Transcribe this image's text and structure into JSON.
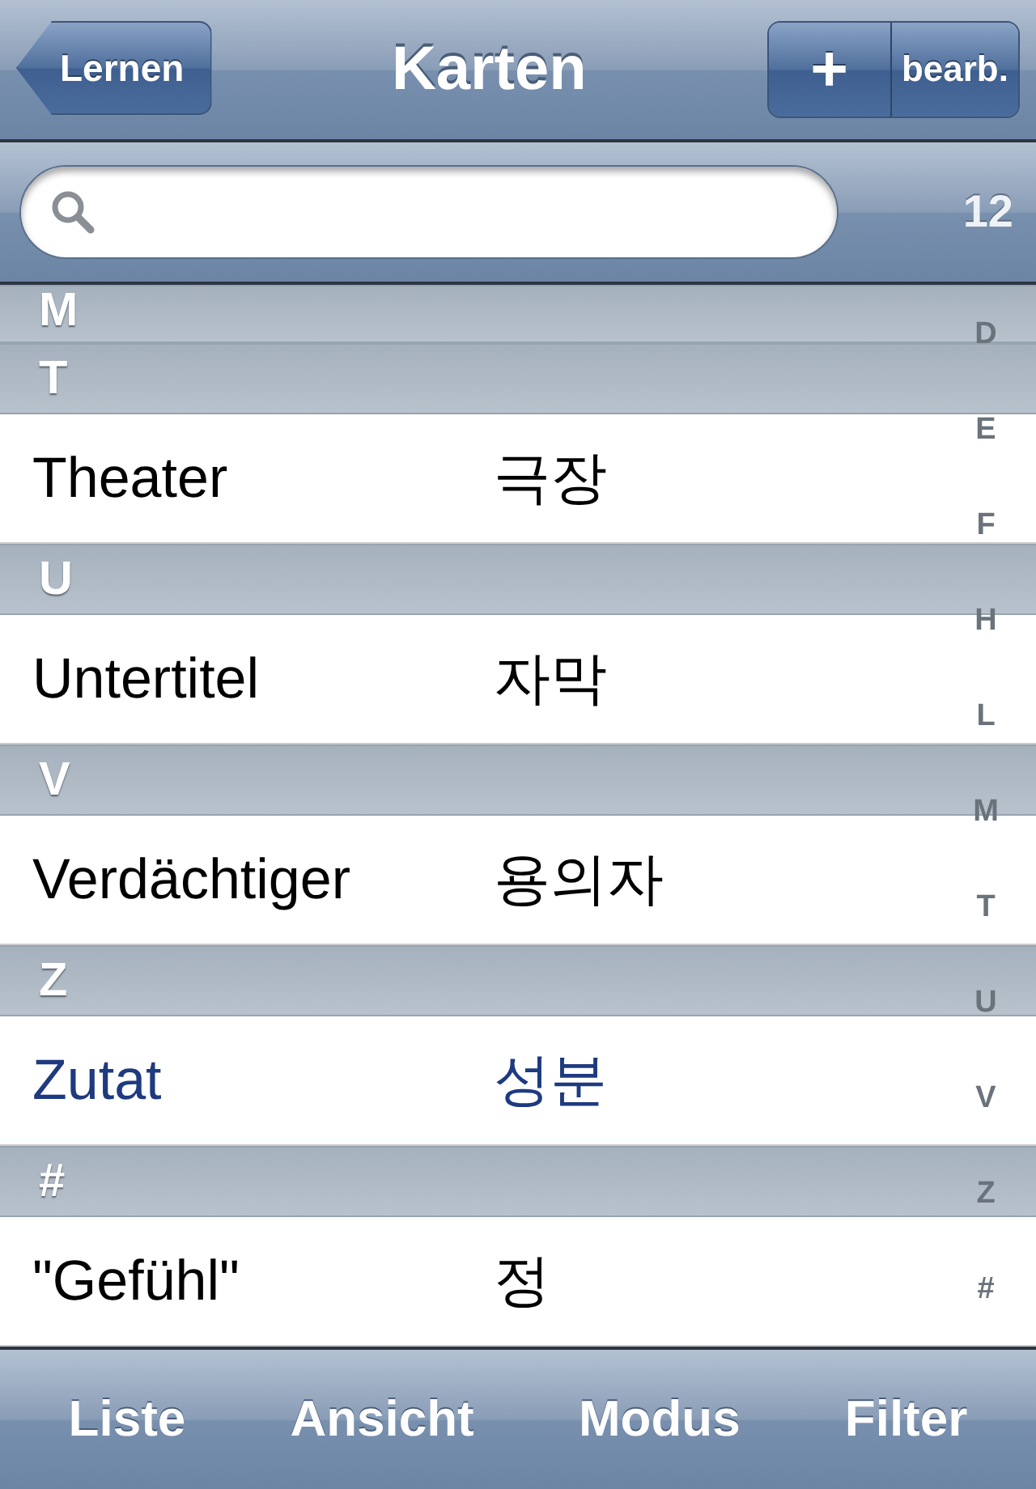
{
  "nav_bar": {
    "back_button": "Lernen",
    "title": "Karten",
    "add_button": "+",
    "edit_button": "bearb."
  },
  "search": {
    "count": "12"
  },
  "sections": [
    {
      "header": "M"
    },
    {
      "header": "T",
      "rows": [
        {
          "term": "Theater",
          "translation": "극장",
          "selected": false
        }
      ]
    },
    {
      "header": "U",
      "rows": [
        {
          "term": "Untertitel",
          "translation": "자막",
          "selected": false
        }
      ]
    },
    {
      "header": "V",
      "rows": [
        {
          "term": "Verdächtiger",
          "translation": "용의자",
          "selected": false
        }
      ]
    },
    {
      "header": "Z",
      "rows": [
        {
          "term": "Zutat",
          "translation": "성분",
          "selected": true
        }
      ]
    },
    {
      "header": "#",
      "rows": [
        {
          "term": "\"Gefühl\"",
          "translation": "정",
          "selected": false
        }
      ]
    }
  ],
  "section_index": [
    "D",
    "E",
    "F",
    "H",
    "L",
    "M",
    "T",
    "U",
    "V",
    "Z",
    "#"
  ],
  "toolbar": [
    "Liste",
    "Ansicht",
    "Modus",
    "Filter"
  ]
}
